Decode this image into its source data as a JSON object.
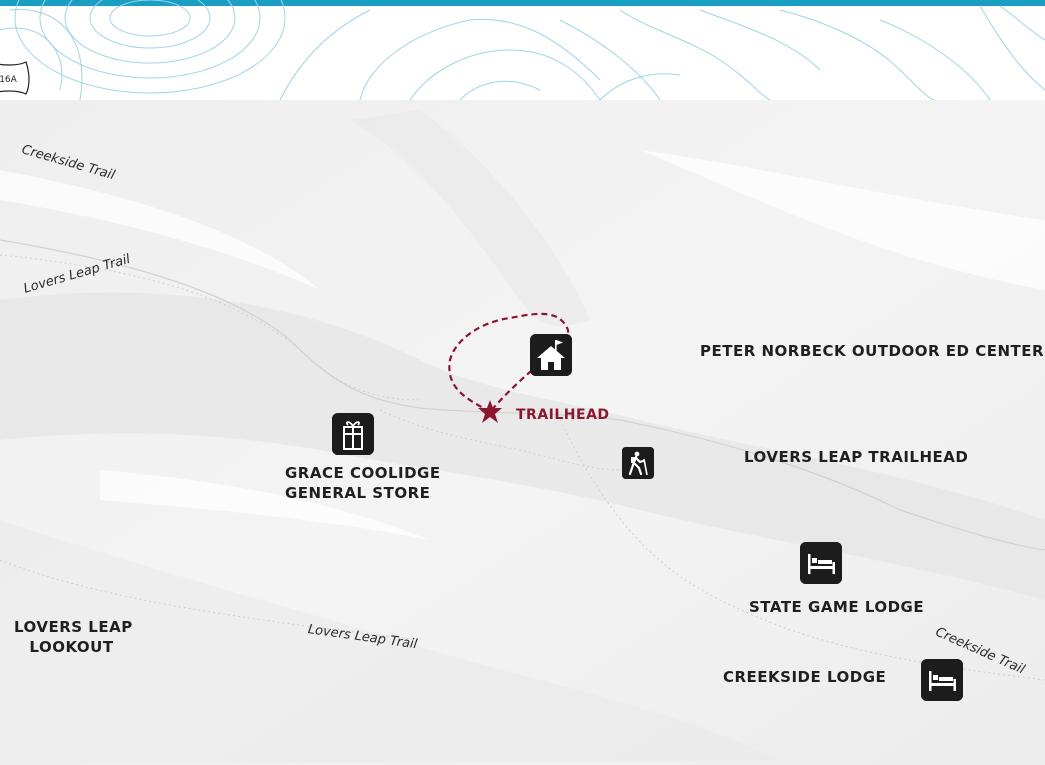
{
  "map": {
    "route_shield": "16A",
    "trailhead_label": "TRAILHEAD",
    "places": {
      "peter_norbeck": "PETER NORBECK OUTDOOR ED CENTER",
      "lovers_leap_trailhead": "LOVERS LEAP TRAILHEAD",
      "grace_coolidge_line1": "GRACE COOLIDGE",
      "grace_coolidge_line2": "GENERAL STORE",
      "state_game_lodge": "STATE GAME LODGE",
      "creekside_lodge": "CREEKSIDE LODGE",
      "lovers_leap_lookout_line1": "LOVERS LEAP",
      "lovers_leap_lookout_line2": "LOOKOUT"
    },
    "trails": {
      "creekside_top": "Creekside Trail",
      "lovers_leap_top": "Lovers Leap Trail",
      "lovers_leap_bottom": "Lovers Leap Trail",
      "creekside_bottom": "Creekside Trail"
    },
    "icons": {
      "education_center": "school-house-icon",
      "store": "gift-box-icon",
      "hiker": "hiker-icon",
      "state_game_lodge": "bed-icon",
      "creekside_lodge": "bed-icon",
      "trailhead": "star-icon"
    },
    "colors": {
      "top_band": "#1a9fc4",
      "contour_top": "#8fcfe4",
      "trail_route": "#8c1630",
      "poi_background": "#1c1c1c"
    }
  }
}
